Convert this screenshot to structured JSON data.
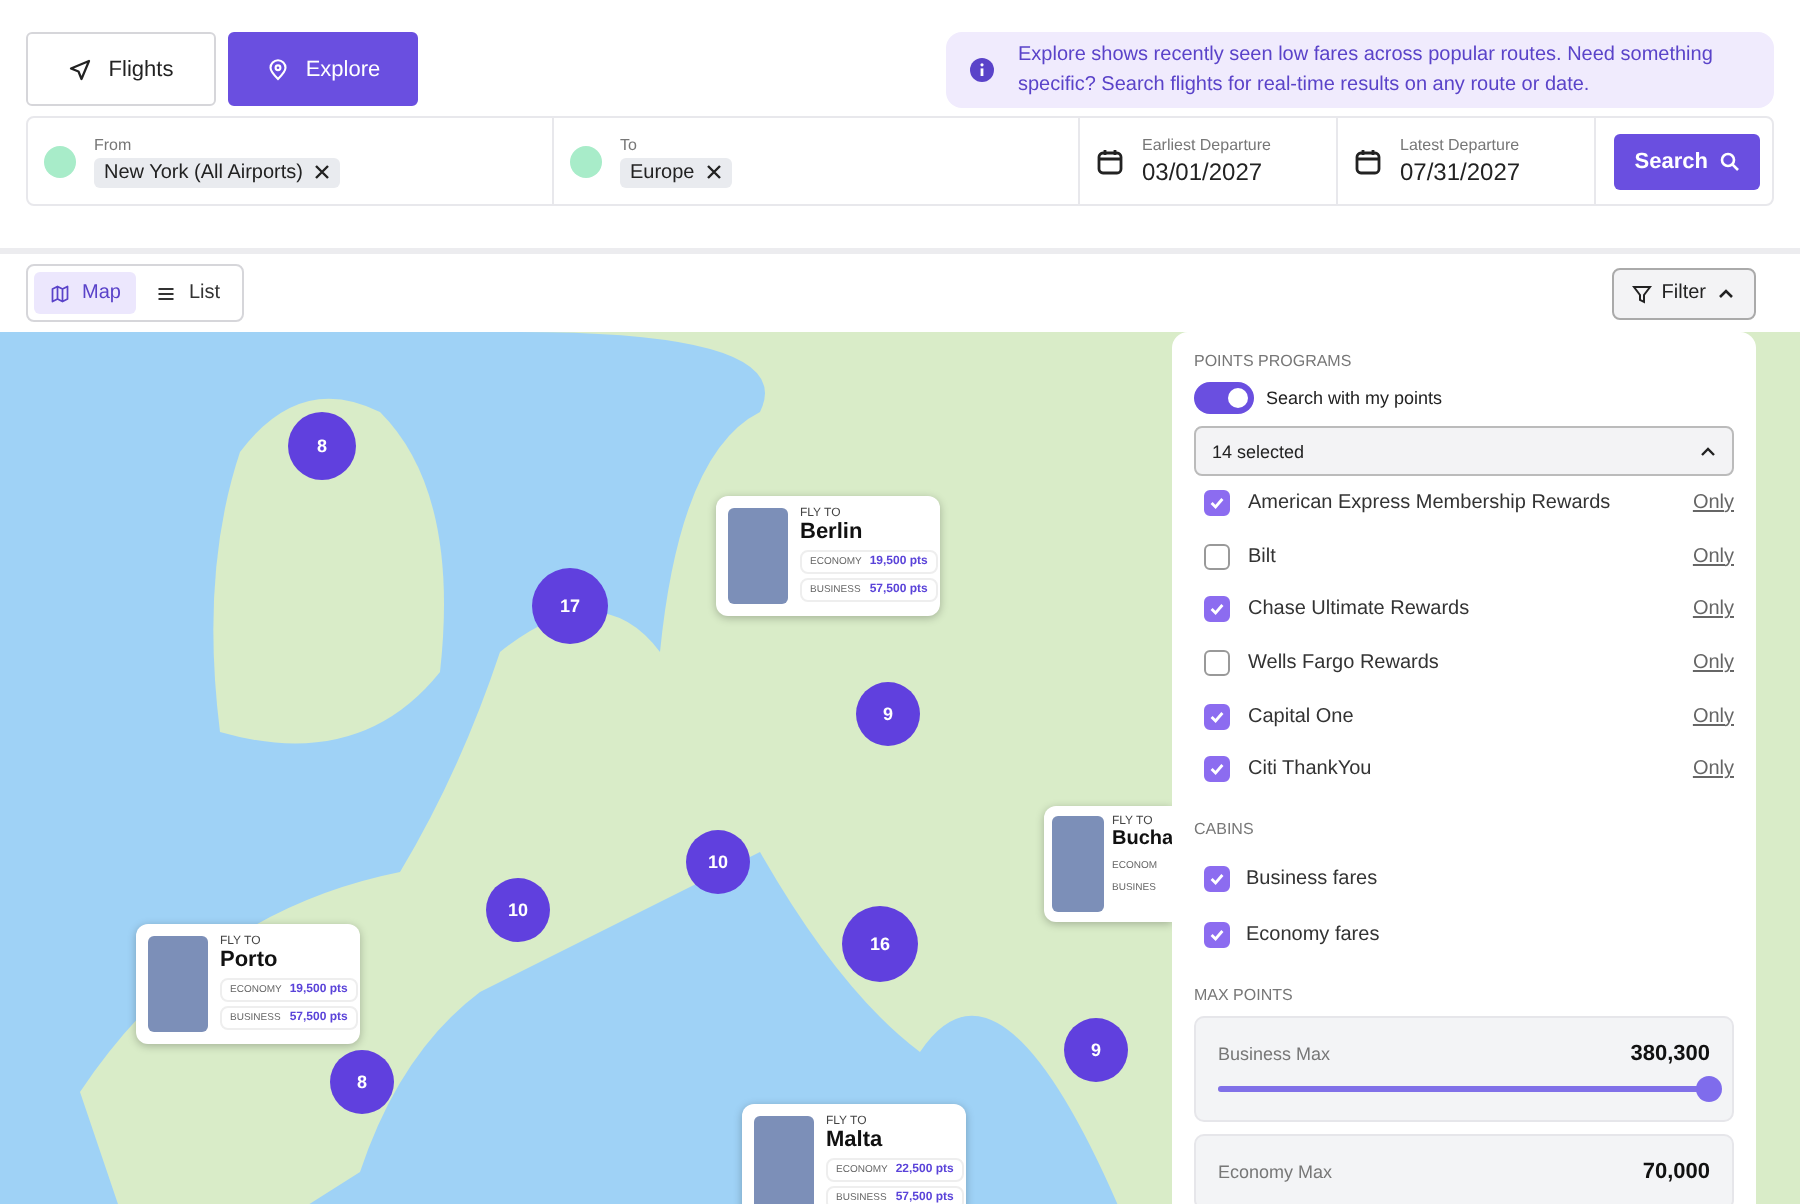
{
  "mode_tabs": [
    {
      "label": "Flights",
      "kind": "plane",
      "selected": false
    },
    {
      "label": "Explore",
      "kind": "pin",
      "selected": true
    }
  ],
  "info_banner": {
    "text": "Explore shows recently seen low fares across popular routes. Need something specific? Search flights for real-time results on any route or date."
  },
  "search_bar": {
    "from": {
      "label": "From",
      "chip": "New York (All Airports)"
    },
    "to": {
      "label": "To",
      "chip": "Europe"
    },
    "dates": [
      {
        "label": "Earliest Departure",
        "value": "03/01/2027"
      },
      {
        "label": "Latest Departure",
        "value": "07/31/2027"
      }
    ],
    "button": "Search"
  },
  "view_toggle": [
    {
      "label": "Map",
      "kind": "map",
      "selected": true
    },
    {
      "label": "List",
      "kind": "list",
      "selected": false
    }
  ],
  "filter_button": {
    "label": "Filter",
    "expanded": true
  },
  "map": {
    "clusters": [
      {
        "count": "8"
      },
      {
        "count": "17"
      },
      {
        "count": "9"
      },
      {
        "count": "10"
      },
      {
        "count": "10"
      },
      {
        "count": "16"
      },
      {
        "count": "8"
      },
      {
        "count": "9"
      }
    ],
    "destinations": [
      {
        "eyebrow": "FLY TO",
        "city": "Berlin",
        "fares": [
          {
            "cabin": "ECONOMY",
            "points": "19,500 pts"
          },
          {
            "cabin": "BUSINESS",
            "points": "57,500 pts"
          }
        ]
      },
      {
        "eyebrow": "FLY TO",
        "city": "Bucha",
        "kind": "clipped",
        "fares": [
          {
            "cabin": "ECONOM"
          },
          {
            "cabin": "BUSINES"
          }
        ]
      },
      {
        "eyebrow": "FLY TO",
        "city": "Porto",
        "fares": [
          {
            "cabin": "ECONOMY",
            "points": "19,500 pts"
          },
          {
            "cabin": "BUSINESS",
            "points": "57,500 pts"
          }
        ]
      },
      {
        "eyebrow": "FLY TO",
        "city": "Malta",
        "fares": [
          {
            "cabin": "ECONOMY",
            "points": "22,500 pts"
          },
          {
            "cabin": "BUSINESS",
            "points": "57,500 pts"
          }
        ]
      }
    ]
  },
  "filter_panel": {
    "points_heading": "POINTS PROGRAMS",
    "toggle": {
      "label": "Search with my points",
      "on": true
    },
    "dropdown": {
      "value": "14 selected",
      "expanded": true
    },
    "programs": [
      {
        "name": "American Express Membership Rewards",
        "checked": true,
        "action": "Only"
      },
      {
        "name": "Bilt",
        "checked": false,
        "action": "Only"
      },
      {
        "name": "Chase Ultimate Rewards",
        "checked": true,
        "action": "Only"
      },
      {
        "name": "Wells Fargo Rewards",
        "checked": false,
        "action": "Only"
      },
      {
        "name": "Capital One",
        "checked": true,
        "action": "Only"
      },
      {
        "name": "Citi ThankYou",
        "checked": true,
        "action": "Only"
      }
    ],
    "cabins_heading": "CABINS",
    "cabins": [
      {
        "name": "Business fares",
        "checked": true
      },
      {
        "name": "Economy fares",
        "checked": true
      }
    ],
    "max_heading": "MAX POINTS",
    "sliders": [
      {
        "label": "Business Max",
        "value": "380,300",
        "level": 1
      },
      {
        "label": "Economy Max",
        "value": "70,000"
      }
    ]
  }
}
